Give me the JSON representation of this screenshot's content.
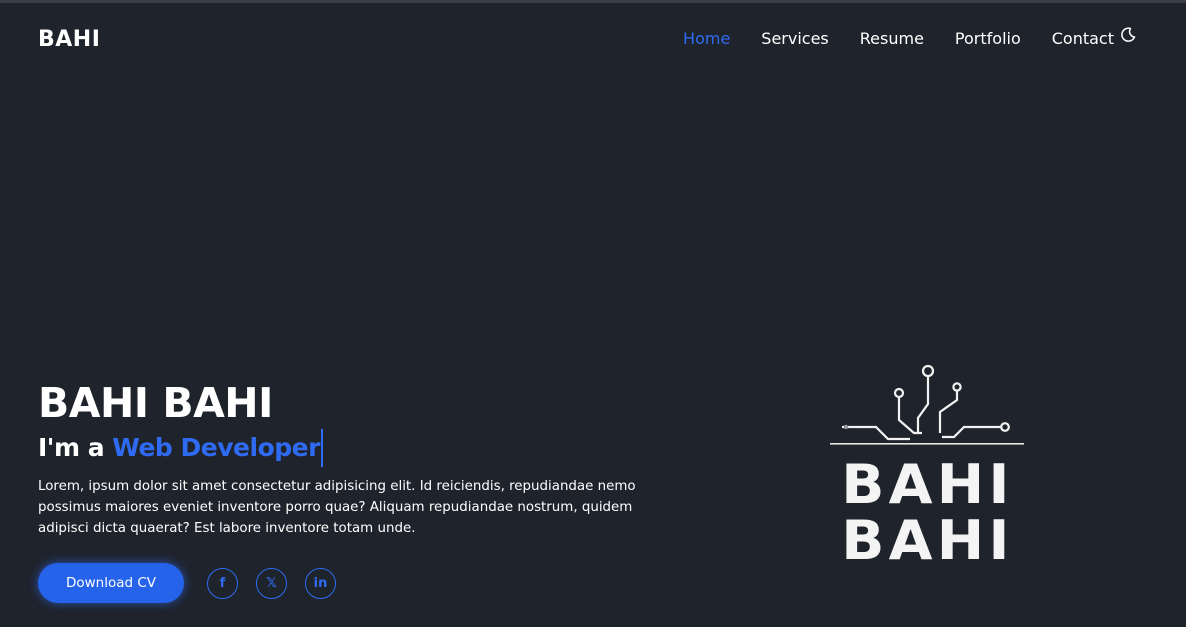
{
  "brand": "BAHI",
  "nav": {
    "items": [
      {
        "label": "Home",
        "active": true
      },
      {
        "label": "Services"
      },
      {
        "label": "Resume"
      },
      {
        "label": "Portfolio"
      },
      {
        "label": "Contact"
      }
    ],
    "theme_icon": "moon-icon"
  },
  "hero": {
    "name": "BAHI BAHI",
    "role_prefix": "I'm a ",
    "role_highlight": "Web Developer",
    "description": "Lorem, ipsum dolor sit amet consectetur adipisicing elit. Id reiciendis, repudiandae nemo possimus maiores eveniet inventore porro quae? Aliquam repudiandae nostrum, quidem adipisci dicta quaerat? Est labore inventore totam unde.",
    "download_label": "Download CV",
    "socials": [
      {
        "icon": "facebook-icon",
        "glyph": "f"
      },
      {
        "icon": "x-icon",
        "glyph": "𝕏"
      },
      {
        "icon": "linkedin-icon",
        "glyph": "in"
      }
    ]
  },
  "logo": {
    "line1": "BAHI",
    "line2": "BAHI"
  },
  "colors": {
    "background": "#1f232c",
    "accent": "#2f6bf2",
    "text": "#ffffff"
  }
}
